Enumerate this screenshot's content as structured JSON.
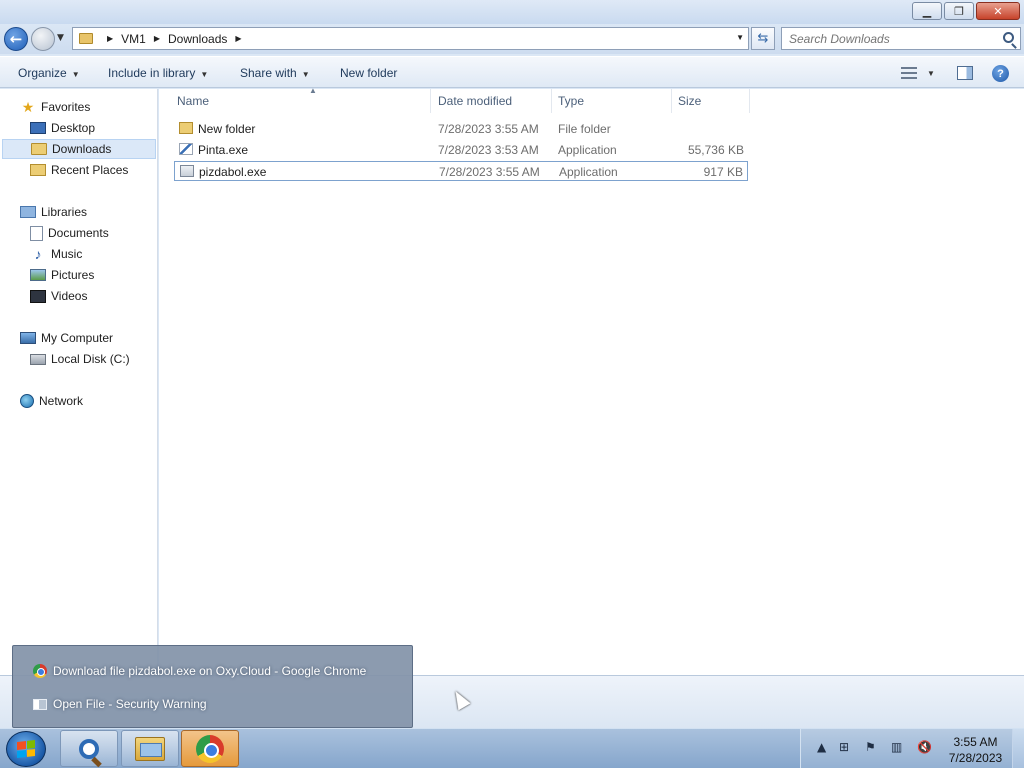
{
  "window": {
    "minimize_glyph": "▁",
    "restore_glyph": "❐",
    "close_glyph": "✕"
  },
  "address": {
    "crumbs": [
      "VM1",
      "Downloads"
    ],
    "search_placeholder": "Search Downloads"
  },
  "toolbar": {
    "organize": "Organize",
    "include_in_library": "Include in library",
    "share_with": "Share with",
    "new_folder": "New folder"
  },
  "sidebar": {
    "favorites": "Favorites",
    "desktop": "Desktop",
    "downloads": "Downloads",
    "recent_places": "Recent Places",
    "libraries": "Libraries",
    "documents": "Documents",
    "music": "Music",
    "pictures": "Pictures",
    "videos": "Videos",
    "my_computer": "My Computer",
    "local_disk": "Local Disk (C:)",
    "network": "Network"
  },
  "columns": {
    "name": "Name",
    "date_modified": "Date modified",
    "type": "Type",
    "size": "Size"
  },
  "files": [
    {
      "name": "New folder",
      "date": "7/28/2023 3:55 AM",
      "type": "File folder",
      "size": "",
      "icon": "folder-icon"
    },
    {
      "name": "Pinta.exe",
      "date": "7/28/2023 3:53 AM",
      "type": "Application",
      "size": "55,736 KB",
      "icon": "pinta-app-icon"
    },
    {
      "name": "pizdabol.exe",
      "date": "7/28/2023 3:55 AM",
      "type": "Application",
      "size": "917 KB",
      "icon": "application-icon",
      "selected": true
    }
  ],
  "taskbar_popup": {
    "items": [
      {
        "label": "Download file pizdabol.exe on Oxy.Cloud - Google Chrome",
        "icon": "chrome-icon"
      },
      {
        "label": "Open File - Security Warning",
        "icon": "window-icon"
      }
    ]
  },
  "taskbar": {
    "pinned": [
      "search-magnifier-icon",
      "windows-explorer-icon",
      "chrome-icon"
    ],
    "active": "chrome-icon",
    "clock_time": "3:55 AM",
    "clock_date": "7/28/2023"
  },
  "colors": {
    "accent": "#1f5fb8",
    "selection": "#dbe8f8",
    "taskbar": "#86a6cc"
  }
}
